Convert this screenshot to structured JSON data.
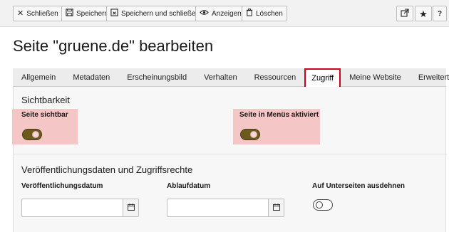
{
  "toolbar": {
    "close_label": "Schließen",
    "save_label": "Speichern",
    "save_close_label": "Speichern und schließen",
    "view_label": "Anzeigen",
    "delete_label": "Löschen",
    "help_label": "?"
  },
  "page": {
    "title": "Seite \"gruene.de\" bearbeiten"
  },
  "tabs": [
    {
      "label": "Allgemein"
    },
    {
      "label": "Metadaten"
    },
    {
      "label": "Erscheinungsbild"
    },
    {
      "label": "Verhalten"
    },
    {
      "label": "Ressourcen"
    },
    {
      "label": "Zugriff",
      "active": true
    },
    {
      "label": "Meine Website"
    },
    {
      "label": "Erweitert"
    }
  ],
  "visibility": {
    "title": "Sichtbarkeit",
    "page_visible_label": "Seite sichtbar",
    "page_visible_state": "on",
    "menu_active_label": "Seite in Menüs aktiviert",
    "menu_active_state": "on"
  },
  "publishing": {
    "title": "Veröffentlichungsdaten und Zugriffsrechte",
    "publish_date_label": "Veröffentlichungsdatum",
    "publish_date_value": "",
    "expiry_date_label": "Ablaufdatum",
    "expiry_date_value": "",
    "extend_label": "Auf Unterseiten ausdehnen",
    "extend_state": "off"
  },
  "colors": {
    "highlight": "#f5c6c6",
    "active_tab_border": "#d0021b",
    "toggle_on": "#6b5a1c"
  }
}
